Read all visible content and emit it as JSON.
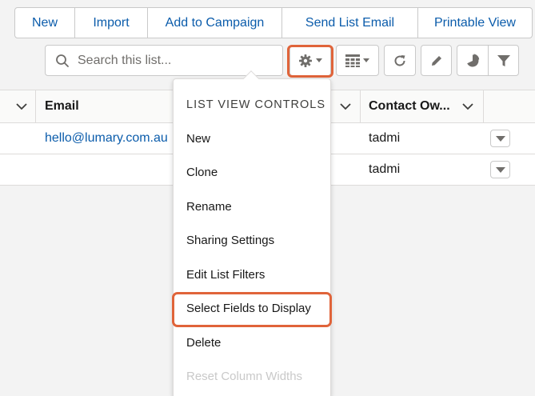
{
  "toolbar": {
    "buttons": [
      "New",
      "Import",
      "Add to Campaign",
      "Send List Email",
      "Printable View"
    ],
    "search_placeholder": "Search this list..."
  },
  "table": {
    "columns": [
      "Email",
      "Contact Ow..."
    ],
    "rows": [
      {
        "email": "hello@lumary.com.au",
        "owner": "tadmi"
      },
      {
        "email": "",
        "owner": "tadmi"
      }
    ]
  },
  "menu": {
    "header": "LIST VIEW CONTROLS",
    "items": [
      "New",
      "Clone",
      "Rename",
      "Sharing Settings",
      "Edit List Filters",
      "Select Fields to Display",
      "Delete",
      "Reset Column Widths"
    ],
    "highlighted_item": "Select Fields to Display",
    "disabled_item": "Reset Column Widths"
  },
  "colors": {
    "link": "#0b5cab",
    "highlight": "#e0643a",
    "border": "#c9c9c9"
  },
  "icons": [
    "search-icon",
    "gear-icon",
    "table-view-icon",
    "refresh-icon",
    "pencil-icon",
    "chart-icon",
    "filter-icon",
    "chevron-down-icon"
  ]
}
